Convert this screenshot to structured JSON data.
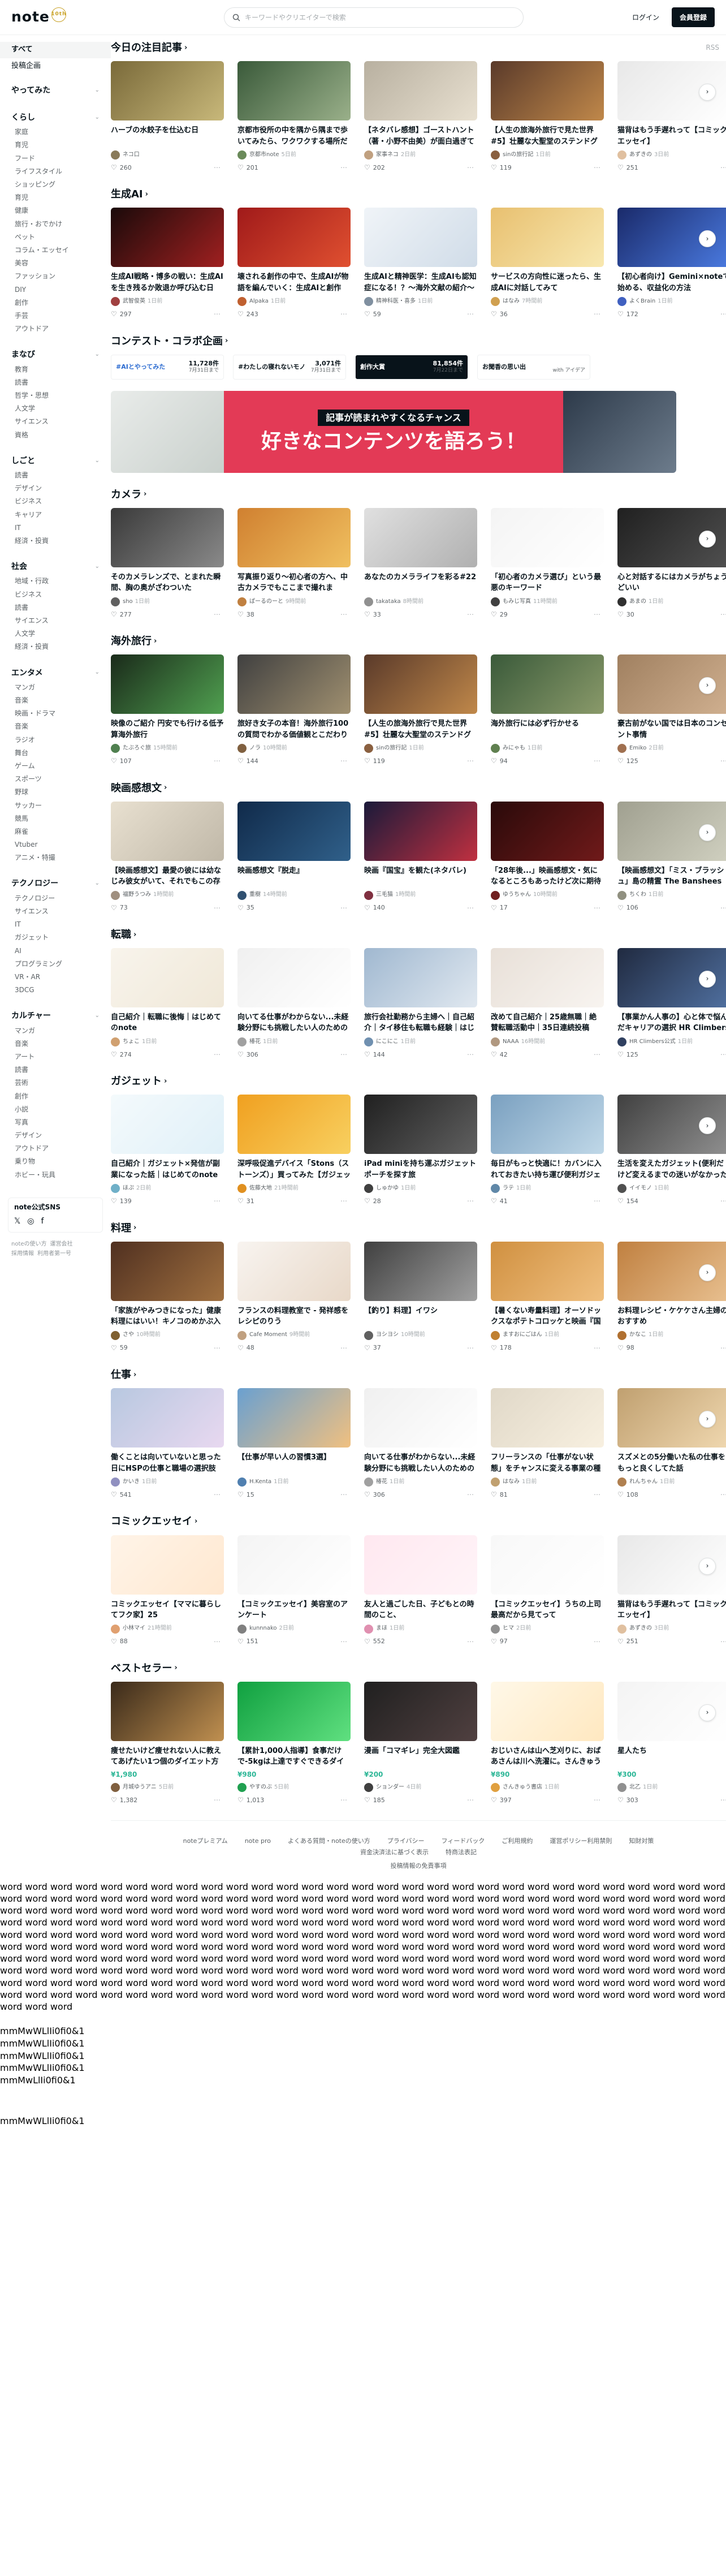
{
  "header": {
    "logo": "note",
    "logo_badge": "10th",
    "search_placeholder": "キーワードやクリエイターで検索",
    "login": "ログイン",
    "signup": "会員登録"
  },
  "sidebar": {
    "top": [
      "すべて",
      "投稿企画"
    ],
    "groups": [
      {
        "title": "やってみた",
        "subs": []
      },
      {
        "title": "くらし",
        "subs": [
          "家庭",
          "育児",
          "フード",
          "ライフスタイル",
          "ショッピング",
          "育児",
          "健康",
          "旅行・おでかけ",
          "ペット",
          "コラム・エッセイ",
          "美容",
          "ファッション",
          "DIY",
          "創作",
          "手芸",
          "アウトドア"
        ]
      },
      {
        "title": "まなび",
        "subs": [
          "教育",
          "読書",
          "哲学・思想",
          "人文学",
          "サイエンス",
          "資格"
        ]
      },
      {
        "title": "しごと",
        "subs": [
          "読書",
          "デザイン",
          "ビジネス",
          "キャリア",
          "IT",
          "経済・投資"
        ]
      },
      {
        "title": "社会",
        "subs": [
          "地域・行政",
          "ビジネス",
          "読書",
          "サイエンス",
          "人文学",
          "経済・投資"
        ]
      },
      {
        "title": "エンタメ",
        "subs": [
          "マンガ",
          "音楽",
          "映画・ドラマ",
          "音楽",
          "ラジオ",
          "舞台",
          "ゲーム",
          "スポーツ",
          "野球",
          "サッカー",
          "競馬",
          "麻雀",
          "Vtuber",
          "アニメ・特撮"
        ]
      },
      {
        "title": "テクノロジー",
        "subs": [
          "テクノロジー",
          "サイエンス",
          "IT",
          "ガジェット",
          "AI",
          "プログラミング",
          "VR・AR",
          "3DCG"
        ]
      },
      {
        "title": "カルチャー",
        "subs": [
          "マンガ",
          "音楽",
          "アート",
          "読書",
          "芸術",
          "創作",
          "小説",
          "写真",
          "デザイン",
          "アウトドア",
          "乗り物",
          "ホビー・玩具"
        ]
      }
    ],
    "sns_title": "note公式SNS",
    "sns_icons": [
      "𝕏",
      "◎",
      "f"
    ],
    "foot1": [
      "noteの使い方",
      "運営会社"
    ],
    "foot2": [
      "採用情報",
      "利用者第一号"
    ]
  },
  "sections": [
    {
      "title": "今日の注目記事",
      "has_chevron": true,
      "rss": "RSS",
      "cards": [
        {
          "title": "ハーブの水餃子を仕込む日",
          "author": "ネコ口",
          "time": "",
          "likes": "260",
          "bg": "linear-gradient(135deg,#7a6a3a,#c8b87a)",
          "av": "#8a7b5a"
        },
        {
          "title": "京都市役所の中を隅から隅まで歩いてみたら、ワクワクする場所だった",
          "author": "京都市note",
          "time": "5日前",
          "likes": "201",
          "bg": "linear-gradient(135deg,#3a5a3a,#9ab08a)",
          "av": "#6a8a5a"
        },
        {
          "title": "【ネタバレ感想】ゴーストハント（著・小野不由美）が面白過ぎて令和の世に...",
          "author": "家事ネコ",
          "time": "2日前",
          "likes": "202",
          "bg": "linear-gradient(135deg,#b8b0a0,#e8e0d0)",
          "av": "#c0a080"
        },
        {
          "title": "【人生の旅海外旅行で見た世界#5】壮麗な大聖堂のステンドグラスに魅了さ...",
          "author": "sinの旅行記",
          "time": "1日前",
          "likes": "119",
          "bg": "linear-gradient(135deg,#5a3a2a,#c0884a)",
          "av": "#8a6040"
        },
        {
          "title": "猫背はもう手遅れって【コミックエッセイ】",
          "author": "あずきの",
          "time": "3日前",
          "likes": "251",
          "bg": "linear-gradient(135deg,#e8e8e8,#ffffff)",
          "av": "#e0c0a0"
        }
      ]
    },
    {
      "title": "生成AI",
      "has_chevron": true,
      "rss": "",
      "cards": [
        {
          "title": "生成AI戦略・博多の戦い：生成AIを生き残るか敗退か呼び込む日",
          "author": "武智俊英",
          "time": "1日前",
          "likes": "297",
          "bg": "linear-gradient(135deg,#1a0a0a,#a02020)",
          "av": "#a04040"
        },
        {
          "title": "壊される創作の中で、生成AIが物語を編んでいく：生成AIと創作",
          "author": "Alpaka",
          "time": "1日前",
          "likes": "243",
          "bg": "linear-gradient(135deg,#a01a1a,#e05030)",
          "av": "#c06030"
        },
        {
          "title": "生成AIと精神医学：生成AIも認知症になる！？〜海外文献の紹介〜",
          "author": "精神科医・喜多",
          "time": "1日前",
          "likes": "59",
          "bg": "linear-gradient(135deg,#f0f4f8,#d0dce8)",
          "av": "#8090a0"
        },
        {
          "title": "サービスの方向性に迷ったら、生成AIに対話してみて",
          "author": "はなみ",
          "time": "7時間前",
          "likes": "36",
          "bg": "linear-gradient(135deg,#e8c070,#f8e8b0)",
          "av": "#d0a050"
        },
        {
          "title": "【初心者向け】Gemini×noteで始める、収益化の方法",
          "author": "よくBrain",
          "time": "1日前",
          "likes": "172",
          "bg": "linear-gradient(135deg,#1a2a6a,#4a7ae0)",
          "av": "#4060c0"
        }
      ]
    }
  ],
  "collab": {
    "title": "コンテスト・コラボ企画",
    "banners": [
      {
        "left": "#AIとやってみた",
        "right_top": "11,728件",
        "right_bot": "7月31日まで"
      },
      {
        "left": "#わたしの寝れないモノ",
        "right_top": "3,071件",
        "right_bot": "7月31日まで"
      },
      {
        "left": "創作大賞",
        "right_top": "81,854件",
        "right_bot": "7月22日まで"
      },
      {
        "left": "お聞香の思い出",
        "right_top": "",
        "right_bot": "with アイデア"
      }
    ],
    "hero_sub": "記事が読まれやすくなるチャンス",
    "hero_main": "好きなコンテンツを語ろう！"
  },
  "sections2": [
    {
      "title": "カメラ",
      "cards": [
        {
          "title": "そのカメラレンズで、とまれた瞬間、胸の奥がざわついた",
          "author": "sho",
          "time": "1日前",
          "likes": "277",
          "bg": "linear-gradient(135deg,#3a3a3a,#8a8a8a)",
          "av": "#606060"
        },
        {
          "title": "写真振り返り〜初心者の方へ、中古カメラでもここまで撮れます!!〜",
          "author": "ぱーるのーと",
          "time": "9時間前",
          "likes": "38",
          "bg": "linear-gradient(135deg,#d08030,#f0c060)",
          "av": "#c08040"
        },
        {
          "title": "あなたのカメラライフを彩る#22",
          "author": "takataka",
          "time": "8時間前",
          "likes": "33",
          "bg": "linear-gradient(135deg,#e0e0e0,#b0b0b0)",
          "av": "#909090"
        },
        {
          "title": "「初心者のカメラ選び」という最悪のキーワード",
          "author": "もみじ写真",
          "time": "11時間前",
          "likes": "29",
          "bg": "linear-gradient(135deg,#f4f4f4,#ffffff)",
          "av": "#404040"
        },
        {
          "title": "心と対話するにはカメラがちょうどいい",
          "author": "あまの",
          "time": "1日前",
          "likes": "30",
          "bg": "linear-gradient(135deg,#202020,#505050)",
          "av": "#303030"
        }
      ]
    },
    {
      "title": "海外旅行",
      "cards": [
        {
          "title": "映像のご紹介 円安でも行ける低予算海外旅行",
          "author": "たぶろぐ旅",
          "time": "15時間前",
          "likes": "107",
          "bg": "linear-gradient(135deg,#1a2a1a,#50a050)",
          "av": "#508050"
        },
        {
          "title": "旅好き女子の本音！海外旅行100の質問でわかる価値観とこだわり",
          "author": "ノラ",
          "time": "10時間前",
          "likes": "144",
          "bg": "linear-gradient(135deg,#404040,#a09070)",
          "av": "#806040"
        },
        {
          "title": "【人生の旅海外旅行で見た世界#5】壮麗な大聖堂のステンドグラスに魅了され...",
          "author": "sinの旅行記",
          "time": "1日前",
          "likes": "119",
          "bg": "linear-gradient(135deg,#5a3a2a,#c0884a)",
          "av": "#8a6040"
        },
        {
          "title": "海外旅行には必ず行かせる",
          "author": "みにゃも",
          "time": "1日前",
          "likes": "94",
          "bg": "linear-gradient(135deg,#3a5a3a,#8a9a6a)",
          "av": "#608050"
        },
        {
          "title": "豪古前がない国では日本のコンセント事情",
          "author": "Emiko",
          "time": "2日前",
          "likes": "125",
          "bg": "linear-gradient(135deg,#a08060,#d0b090)",
          "av": "#a07050"
        }
      ]
    },
    {
      "title": "映画感想文",
      "cards": [
        {
          "title": "【映画感想文】最愛の彼には幼なじみ彼女がいて、それでもこの存在はあんなに愛...",
          "author": "福野うつみ",
          "time": "1時間前",
          "likes": "73",
          "bg": "linear-gradient(135deg,#e8e0d0,#c0b8a8)",
          "av": "#a09080"
        },
        {
          "title": "映画感想文『脱走』",
          "author": "重樹",
          "time": "14時間前",
          "likes": "35",
          "bg": "linear-gradient(135deg,#102a4a,#30608a)",
          "av": "#305070"
        },
        {
          "title": "映画『国宝』を観た(ネタバレ)",
          "author": "三毛猫",
          "time": "1時間前",
          "likes": "140",
          "bg": "linear-gradient(135deg,#1a1a3a,#c03040)",
          "av": "#803040"
        },
        {
          "title": "「28年後...」映画感想文・気になるところもあったけど次に期待",
          "author": "ゆうちゃん",
          "time": "10時間前",
          "likes": "17",
          "bg": "linear-gradient(135deg,#2a0a0a,#701a1a)",
          "av": "#702020"
        },
        {
          "title": "【映画感想文】「ミス・ブラッシュ」島の精霊 The Banshees of...",
          "author": "ちくわ",
          "time": "1日前",
          "likes": "106",
          "bg": "linear-gradient(135deg,#a0a090,#d0d0c0)",
          "av": "#909080"
        }
      ]
    },
    {
      "title": "転職",
      "cards": [
        {
          "title": "自己紹介｜転職に後悔｜はじめてのnote",
          "author": "ちょこ",
          "time": "1日前",
          "likes": "274",
          "bg": "linear-gradient(135deg,#f8f4ec,#f0e8d8)",
          "av": "#d0a070"
        },
        {
          "title": "向いてる仕事がわからない...未経験分野にも挑戦したい人のための転職ガイド",
          "author": "椿花",
          "time": "1日前",
          "likes": "306",
          "bg": "linear-gradient(135deg,#f0f0f0,#ffffff)",
          "av": "#a0a0a0"
        },
        {
          "title": "旅行会社勤務から主婦へ｜自己紹介｜タイ移住も転職も経験｜はじめてのnote",
          "author": "にこにこ",
          "time": "1日前",
          "likes": "144",
          "bg": "linear-gradient(135deg,#a0b8d0,#e0e8f0)",
          "av": "#7090b0"
        },
        {
          "title": "改めて自己紹介｜25歳無職｜絶賛転職活動中｜35日連続投稿note",
          "author": "NAAA",
          "time": "16時間前",
          "likes": "42",
          "bg": "linear-gradient(135deg,#e8e0d8,#f8f4f0)",
          "av": "#b09880"
        },
        {
          "title": "【事業かん人事の】心と体で悩んだキャリアの選択 HR Climbers",
          "author": "HR Climbers公式",
          "time": "1日前",
          "likes": "125",
          "bg": "linear-gradient(135deg,#202a40,#5070a0)",
          "av": "#304060"
        }
      ]
    },
    {
      "title": "ガジェット",
      "cards": [
        {
          "title": "自己紹介｜ガジェット×発信が副業になった話｜はじめてのnote",
          "author": "ほぷ",
          "time": "2日前",
          "likes": "139",
          "bg": "linear-gradient(135deg,#f4fafc,#e0f0f8)",
          "av": "#70b0c8"
        },
        {
          "title": "深呼吸促進デバイス「Stons（ストーンズ）」買ってみた【ガジェット】",
          "author": "佐藤大地",
          "time": "21時間前",
          "likes": "31",
          "bg": "linear-gradient(135deg,#f0a020,#f8d060)",
          "av": "#e09020"
        },
        {
          "title": "iPad miniを持ち運ぶガジェットポーチを探す旅",
          "author": "しゅかゆ",
          "time": "1日前",
          "likes": "28",
          "bg": "linear-gradient(135deg,#202020,#606060)",
          "av": "#404040"
        },
        {
          "title": "毎日がもっと快適に！カバンに入れておきたい持ち運び便利ガジェット6選",
          "author": "ラテ",
          "time": "1日前",
          "likes": "41",
          "bg": "linear-gradient(135deg,#7aa0c0,#c0d8e8)",
          "av": "#6088a8"
        },
        {
          "title": "生活を変えたガジェット(便利だけど変えるまでの迷いがなかったガジェット",
          "author": "イイモノ",
          "time": "1日前",
          "likes": "154",
          "bg": "linear-gradient(135deg,#404040,#909090)",
          "av": "#505050"
        }
      ]
    },
    {
      "title": "料理",
      "cards": [
        {
          "title": "「家族がやみつきになった」健康料理にはいい！キノコのめかぶ入りのポトチャラ...",
          "author": "さや",
          "time": "10時間前",
          "likes": "59",
          "bg": "linear-gradient(135deg,#503020,#a07040)",
          "av": "#806030"
        },
        {
          "title": "フランスの料理教室で - 発祥感をレシピのりう",
          "author": "Cafe Moment",
          "time": "9時間前",
          "likes": "48",
          "bg": "linear-gradient(135deg,#f8f4f0,#e8d8c8)",
          "av": "#c0a080"
        },
        {
          "title": "【釣り】料理】イワシ",
          "author": "ヨシヨシ",
          "time": "10時間前",
          "likes": "37",
          "bg": "linear-gradient(135deg,#404040,#a0a0a0)",
          "av": "#606060"
        },
        {
          "title": "【暑くない寿量料理】オーソドックスなポテトコロッケと映画『国宝』鑑賞と蓋葉院",
          "author": "ますおにごはん",
          "time": "1日前",
          "likes": "178",
          "bg": "linear-gradient(135deg,#d09040,#f0c080)",
          "av": "#c08030"
        },
        {
          "title": "お料理レシピ・ケケケさん主婦のおすすめ",
          "author": "かなこ",
          "time": "1日前",
          "likes": "98",
          "bg": "linear-gradient(135deg,#c08040,#e8c090)",
          "av": "#b07030"
        }
      ]
    },
    {
      "title": "仕事",
      "cards": [
        {
          "title": "働くことは向いていないと思った日にHSPの仕事と職場の選択肢",
          "author": "かいき",
          "time": "1日前",
          "likes": "541",
          "bg": "linear-gradient(135deg,#b8c8e0,#e8d8f0)",
          "av": "#9090c0"
        },
        {
          "title": "【仕事が早い人の習慣3選】",
          "author": "H.Kenta",
          "time": "1日前",
          "likes": "15",
          "bg": "linear-gradient(135deg,#6aa0d0,#f0c080)",
          "av": "#5080b0"
        },
        {
          "title": "向いてる仕事がわからない...未経験分野にも挑戦したい人のための転職ガイド",
          "author": "椿花",
          "time": "1日前",
          "likes": "306",
          "bg": "linear-gradient(135deg,#f0f0f0,#ffffff)",
          "av": "#a0a0a0"
        },
        {
          "title": "フリーランスの「仕事がない状態」をチャンスに変える事業の種類",
          "author": "はなみ",
          "time": "1日前",
          "likes": "81",
          "bg": "linear-gradient(135deg,#e0d8c8,#f8f0e0)",
          "av": "#c0a070"
        },
        {
          "title": "スズメとの5分働いた私の仕事をもっと良くしてた話",
          "author": "れんちゃん",
          "time": "1日前",
          "likes": "108",
          "bg": "linear-gradient(135deg,#c0a070,#f0d8b0)",
          "av": "#b08050"
        }
      ]
    },
    {
      "title": "コミックエッセイ",
      "cards": [
        {
          "title": "コミックエッセイ【ママに暮らしてフク家】25",
          "author": "小林マイ",
          "time": "21時間前",
          "likes": "88",
          "bg": "linear-gradient(135deg,#fff4e8,#ffe8d0)",
          "av": "#e0a070"
        },
        {
          "title": "【コミックエッセイ】美容室のアンケート",
          "author": "kunnnako",
          "time": "2日前",
          "likes": "151",
          "bg": "linear-gradient(135deg,#f4f4f4,#ffffff)",
          "av": "#808080"
        },
        {
          "title": "友人と過ごした日、子どもとの時間のこと、",
          "author": "まほ",
          "time": "1日前",
          "likes": "552",
          "bg": "linear-gradient(135deg,#ffe8f0,#fff4f8)",
          "av": "#e090b0"
        },
        {
          "title": "【コミックエッセイ】うちの上司最高だから見てって",
          "author": "ヒマ",
          "time": "2日前",
          "likes": "97",
          "bg": "linear-gradient(135deg,#f8f8f8,#ffffff)",
          "av": "#909090"
        },
        {
          "title": "猫背はもう手遅れって【コミックエッセイ】",
          "author": "あずきの",
          "time": "3日前",
          "likes": "251",
          "bg": "linear-gradient(135deg,#e8e8e8,#ffffff)",
          "av": "#e0c0a0"
        }
      ]
    },
    {
      "title": "ベストセラー",
      "cards": [
        {
          "title": "痩せたいけど痩せれない人に教えてあげたい1つ個のダイエット方法について",
          "price": "¥1,980",
          "author": "月城ゆうアニ",
          "time": "5日前",
          "likes": "1,382",
          "bg": "linear-gradient(135deg,#3a2a1a,#c09050)",
          "av": "#806040"
        },
        {
          "title": "【累計1,000人指導】食事だけで-5kgは上達ですぐできるダイエット成功の秘",
          "price": "¥980",
          "author": "やすのぶ",
          "time": "5日前",
          "likes": "1,013",
          "bg": "linear-gradient(135deg,#10a040,#60e080)",
          "av": "#20a050"
        },
        {
          "title": "漫画「コマギレ」完全大図鑑",
          "price": "¥200",
          "author": "ションダー",
          "time": "4日前",
          "likes": "185",
          "bg": "linear-gradient(135deg,#202020,#504040)",
          "av": "#404040"
        },
        {
          "title": "おじいさんは山へ芝刈りに、おばあさんは川へ洗濯に。さんきゅう書店は東京へ",
          "price": "¥890",
          "author": "さんきゅう書店",
          "time": "1日前",
          "likes": "397",
          "bg": "linear-gradient(135deg,#fff8e8,#ffe8c0)",
          "av": "#e0a040"
        },
        {
          "title": "星人たち",
          "price": "¥300",
          "author": "北乙",
          "time": "1日前",
          "likes": "303",
          "bg": "linear-gradient(135deg,#f4f4f4,#ffffff)",
          "av": "#909090"
        }
      ]
    }
  ],
  "footer": {
    "links": [
      "noteプレミアム",
      "note pro",
      "よくある質問・noteの使い方",
      "プライバシー",
      "フィードバック",
      "ご利用規約",
      "運営ポリシー利用禁則",
      "知財対策",
      "資金決済法に基づく表示",
      "特商法表記"
    ],
    "links2": "投稿情報の免責事項"
  },
  "test_text": "word word word word word word word word word word word word word word word word word word word word word word word word word word word word word word word word word word word word word word word word word word word word word word word word word word word word word word word word word word word word word word word word word word word word word word word word word word word word word word word word word word word word word word word word word word word word word word word word word word word word word word word word word word word word word word word word word word word word word word word word word word word word word word word word word word word word word word word word word word word word word word word word word word word word word word word word word word word word word word word word word word word word word word word word word word word word word word word word word word word word word word word word word word word word word word word word word word word word word word word word word word word word word word word word word word word word word word word word word word word word word word word word word word word word word word word word word word word word word word word word word word word word word word word word word word word word word word word word word word word word word word word word word word word word word word word word word word word word word word word word word word word word word word word word word word word word word",
  "mono_lines": [
    "mmMwWLlIi0fi0&1",
    "mmMwWLlIi0fi0&1",
    "mmMwWLlIi0fi0&1",
    "mmMwWLlIi0fi0&1",
    "mmMwLlIi0fi0&1"
  ],
  "mono_last": "mmMwWLlIi0fi0&1"
}
